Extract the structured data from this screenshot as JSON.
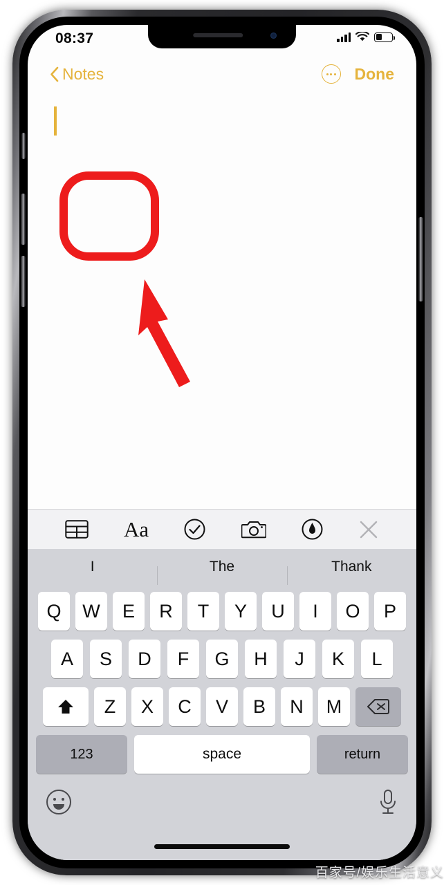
{
  "status_bar": {
    "time": "08:37",
    "signal_icon": "cellular-signal-icon",
    "wifi_icon": "wifi-icon",
    "battery_icon": "battery-icon",
    "battery_percent": 40
  },
  "nav_bar": {
    "back_icon": "chevron-left-icon",
    "back_label": "Notes",
    "more_icon": "more-circle-icon",
    "done_label": "Done",
    "accent_color": "#E5B33C"
  },
  "note": {
    "body_text": "",
    "cursor_color": "#E5B33C"
  },
  "annotation": {
    "color": "#ED1C1C",
    "shapes": [
      "rounded-square-highlight",
      "arrow-pointer"
    ]
  },
  "format_toolbar": {
    "items": [
      {
        "name": "table-icon",
        "label": "table"
      },
      {
        "name": "text-format-icon",
        "label": "Aa"
      },
      {
        "name": "checklist-icon",
        "label": "checklist"
      },
      {
        "name": "camera-icon",
        "label": "camera"
      },
      {
        "name": "markup-pen-icon",
        "label": "markup"
      },
      {
        "name": "close-keyboard-icon",
        "label": "close"
      }
    ]
  },
  "predictive_bar": {
    "suggestions": [
      "I",
      "The",
      "Thank"
    ]
  },
  "keyboard": {
    "row1": [
      "Q",
      "W",
      "E",
      "R",
      "T",
      "Y",
      "U",
      "I",
      "O",
      "P"
    ],
    "row2": [
      "A",
      "S",
      "D",
      "F",
      "G",
      "H",
      "J",
      "K",
      "L"
    ],
    "row3": [
      "Z",
      "X",
      "C",
      "V",
      "B",
      "N",
      "M"
    ],
    "shift_icon": "shift-arrow-icon",
    "backspace_icon": "backspace-icon",
    "numeric_label": "123",
    "space_label": "space",
    "return_label": "return",
    "emoji_icon": "emoji-smiley-icon",
    "dictation_icon": "microphone-icon"
  },
  "watermark": {
    "text": "百家号/娱乐生活意义"
  }
}
